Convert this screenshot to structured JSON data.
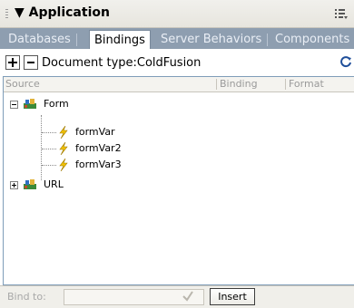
{
  "panel": {
    "title": "Application",
    "tabs": [
      {
        "label": "Databases",
        "active": false
      },
      {
        "label": "Bindings",
        "active": true
      },
      {
        "label": "Server Behaviors",
        "active": false
      },
      {
        "label": "Components",
        "active": false
      }
    ]
  },
  "toolbar": {
    "add_label": "+",
    "remove_label": "−",
    "document_type": "Document type:ColdFusion"
  },
  "table": {
    "columns": [
      "Source",
      "Binding",
      "Format"
    ],
    "tree": [
      {
        "label": "Form",
        "expanded": true,
        "icon": "form-icon",
        "children": [
          "formVar",
          "formVar2",
          "formVar3"
        ]
      },
      {
        "label": "URL",
        "expanded": false,
        "icon": "url-icon",
        "children": []
      }
    ]
  },
  "bottom": {
    "bind_label": "Bind to:",
    "bind_value": "",
    "insert_label": "Insert"
  },
  "colors": {
    "tab_bar": "#8e9eb0",
    "table_border": "#7f9db9",
    "lightning": "#f2c200"
  }
}
